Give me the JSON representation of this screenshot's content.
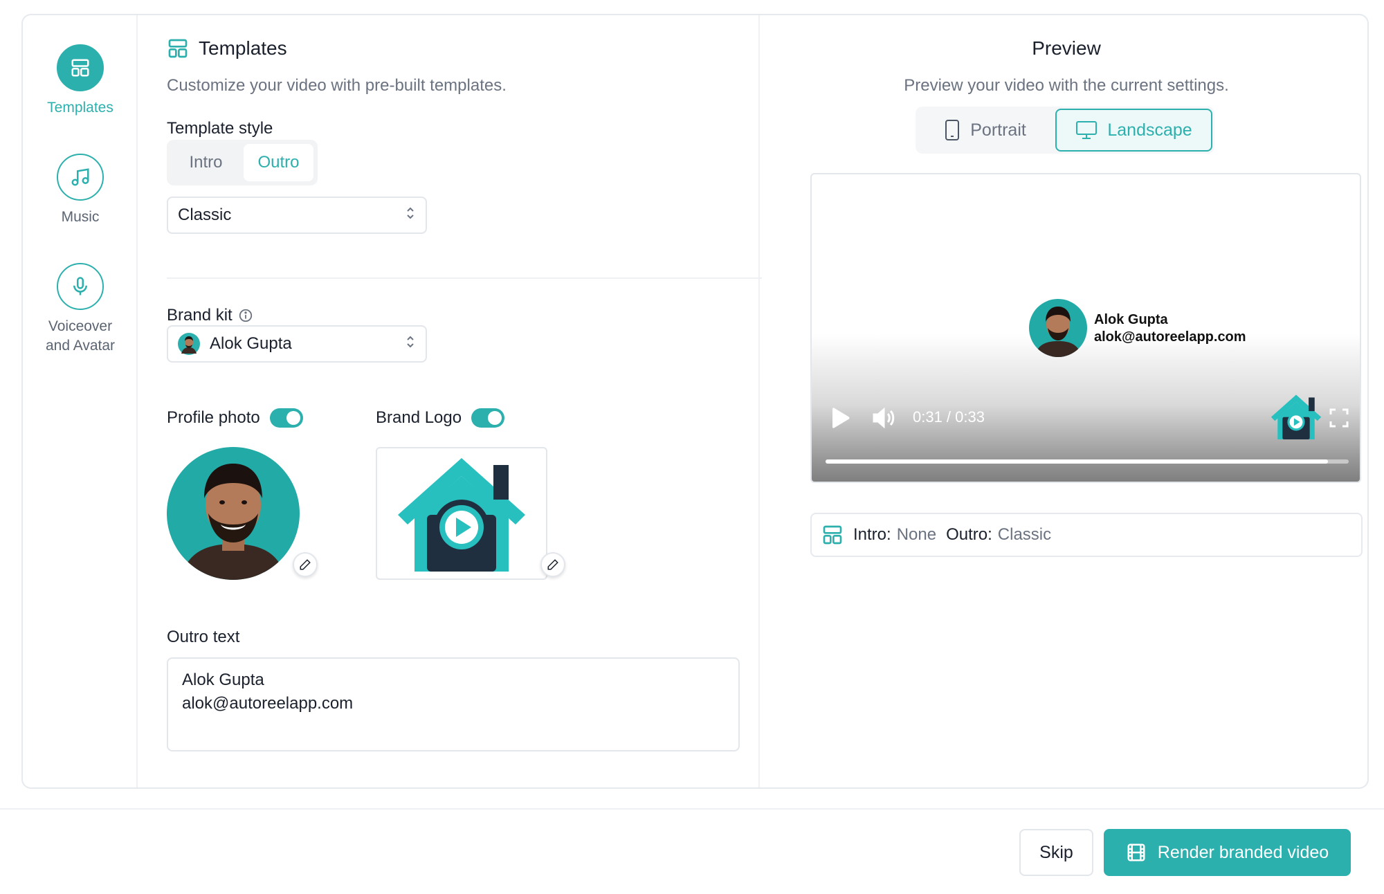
{
  "colors": {
    "accent": "#2cb0ad",
    "muted": "#6b7280",
    "text": "#1a202c"
  },
  "rail": {
    "items": [
      {
        "label": "Templates",
        "icon": "layout-icon",
        "active": true
      },
      {
        "label": "Music",
        "icon": "music-note-icon",
        "active": false
      },
      {
        "label": "Voiceover\nand Avatar",
        "icon": "microphone-icon",
        "active": false
      }
    ]
  },
  "templates": {
    "title": "Templates",
    "subtitle": "Customize your video with pre-built templates.",
    "style_label": "Template style",
    "segment": {
      "intro": "Intro",
      "outro": "Outro",
      "selected": "Outro"
    },
    "style_select": "Classic",
    "brand_kit_label": "Brand kit",
    "brand_kit_value": "Alok Gupta",
    "profile_photo_label": "Profile photo",
    "profile_photo_on": true,
    "brand_logo_label": "Brand Logo",
    "brand_logo_on": true,
    "outro_text_label": "Outro text",
    "outro_text_value": "Alok Gupta\nalok@autoreelapp.com"
  },
  "preview": {
    "title": "Preview",
    "subtitle": "Preview your video with the current settings.",
    "portrait_label": "Portrait",
    "landscape_label": "Landscape",
    "selected_orientation": "Landscape",
    "card_name": "Alok Gupta",
    "card_email": "alok@autoreelapp.com",
    "time": "0:31 / 0:33",
    "progress": 0.96,
    "summary": {
      "intro_label": "Intro:",
      "intro_value": "None",
      "outro_label": "Outro:",
      "outro_value": "Classic"
    }
  },
  "footer": {
    "skip": "Skip",
    "render": "Render branded video"
  }
}
